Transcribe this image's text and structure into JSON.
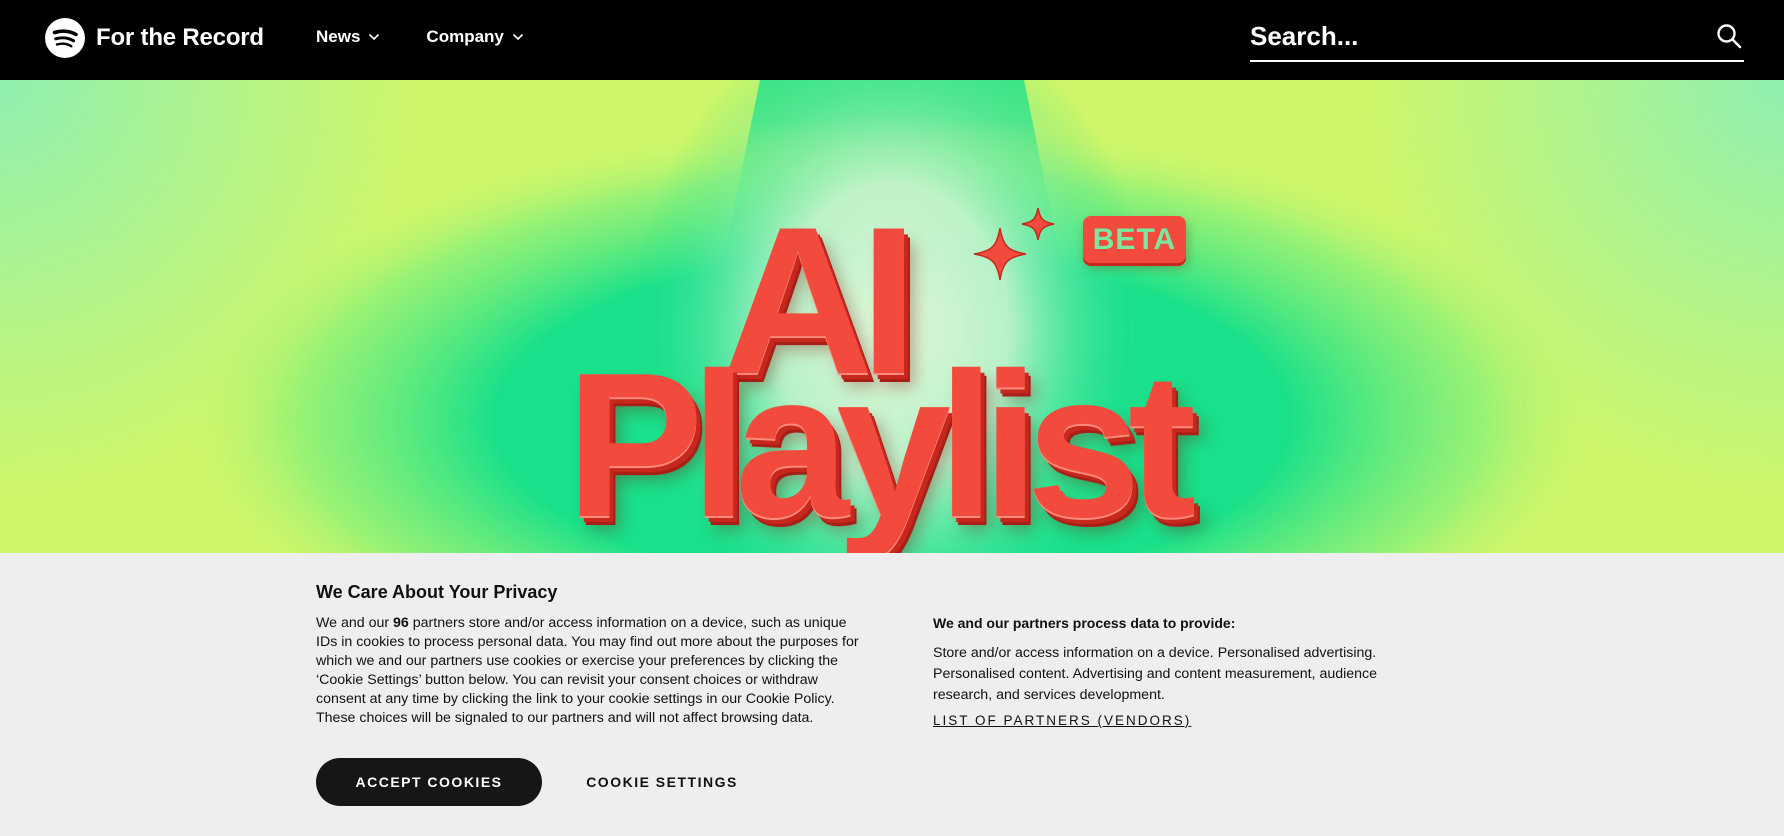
{
  "header": {
    "brand": "For the Record",
    "logo_icon": "spotify-logo-icon",
    "nav": [
      {
        "label": "News",
        "icon": "chevron-down-icon"
      },
      {
        "label": "Company",
        "icon": "chevron-down-icon"
      }
    ],
    "search": {
      "placeholder": "Search...",
      "icon": "search-icon"
    }
  },
  "hero": {
    "title_line1": "AI",
    "title_line2": "Playlist",
    "badge": "BETA",
    "sparkle_icon": "sparkle-icon",
    "colors": {
      "title": "#f24b3d",
      "bg_lime": "#cff66a",
      "bg_green": "#19e08a",
      "badge_text": "#7ae89f"
    }
  },
  "cookie": {
    "title": "We Care About Your Privacy",
    "desc_part1": "We and our ",
    "desc_count": "96",
    "desc_part2": " partners store and/or access information on a device, such as unique IDs in cookies to process personal data. You may find out more about the purposes for which we and our partners use cookies or exercise your preferences by clicking the ‘Cookie Settings’ button below. You can revisit your consent choices or withdraw consent at any time by clicking the link to your cookie settings in our Cookie Policy. These choices will be signaled to our partners and will not affect browsing data.",
    "right_heading": "We and our partners process data to provide:",
    "right_body": "Store and/or access information on a device. Personalised advertising. Personalised content. Advertising and content measurement, audience research, and services development.",
    "vendors_link": "LIST OF PARTNERS (VENDORS)",
    "accept_label": "ACCEPT COOKIES",
    "settings_label": "COOKIE SETTINGS"
  }
}
